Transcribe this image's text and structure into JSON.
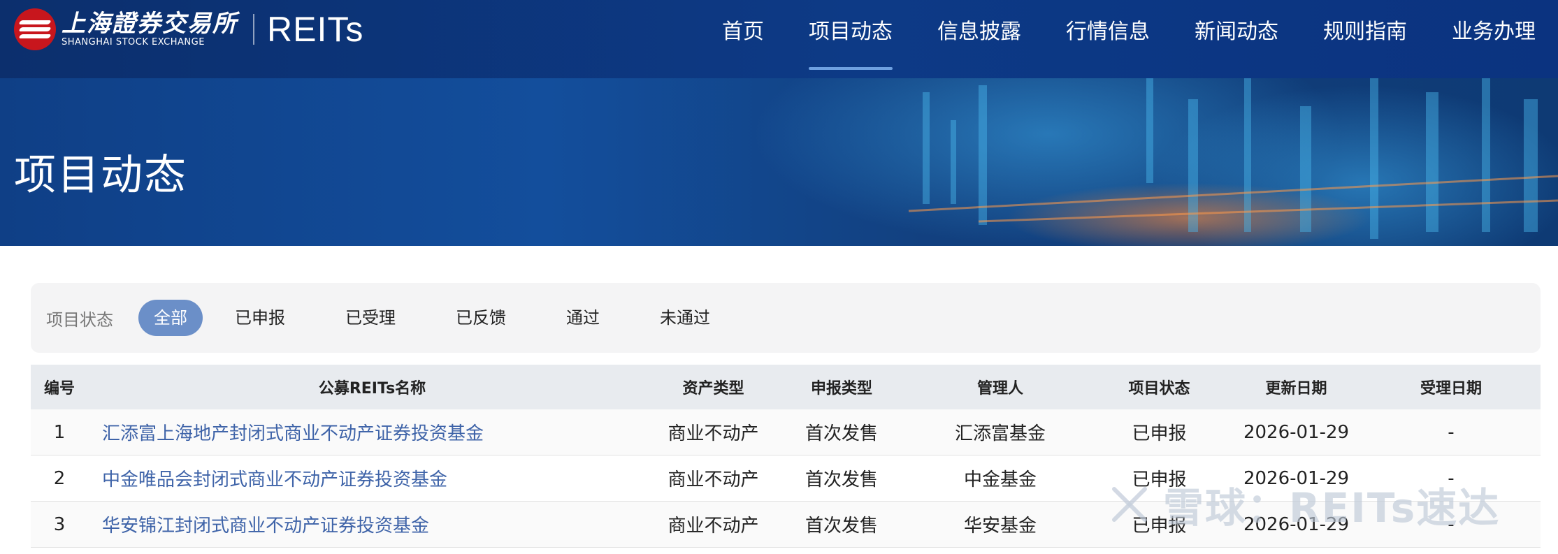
{
  "header": {
    "logo_cn": "上海證券交易所",
    "logo_en": "SHANGHAI STOCK EXCHANGE",
    "product": "REITs",
    "nav": [
      {
        "label": "首页",
        "active": false
      },
      {
        "label": "项目动态",
        "active": true
      },
      {
        "label": "信息披露",
        "active": false
      },
      {
        "label": "行情信息",
        "active": false
      },
      {
        "label": "新闻动态",
        "active": false
      },
      {
        "label": "规则指南",
        "active": false
      },
      {
        "label": "业务办理",
        "active": false
      }
    ]
  },
  "banner": {
    "title": "项目动态"
  },
  "filter": {
    "label": "项目状态",
    "options": [
      {
        "label": "全部",
        "active": true
      },
      {
        "label": "已申报",
        "active": false
      },
      {
        "label": "已受理",
        "active": false
      },
      {
        "label": "已反馈",
        "active": false
      },
      {
        "label": "通过",
        "active": false
      },
      {
        "label": "未通过",
        "active": false
      }
    ]
  },
  "table": {
    "columns": [
      "编号",
      "公募REITs名称",
      "资产类型",
      "申报类型",
      "管理人",
      "项目状态",
      "更新日期",
      "受理日期"
    ],
    "rows": [
      [
        "1",
        "汇添富上海地产封闭式商业不动产证券投资基金",
        "商业不动产",
        "首次发售",
        "汇添富基金",
        "已申报",
        "2026-01-29",
        "-"
      ],
      [
        "2",
        "中金唯品会封闭式商业不动产证券投资基金",
        "商业不动产",
        "首次发售",
        "中金基金",
        "已申报",
        "2026-01-29",
        "-"
      ],
      [
        "3",
        "华安锦江封闭式商业不动产证券投资基金",
        "商业不动产",
        "首次发售",
        "华安基金",
        "已申报",
        "2026-01-29",
        "-"
      ]
    ]
  },
  "watermark": {
    "text": "雪球：REITs速达"
  },
  "colors": {
    "header_bg": "#0d3a86",
    "accent": "#6b8fc8",
    "link": "#3e63a8",
    "logo_red": "#c8161d"
  }
}
